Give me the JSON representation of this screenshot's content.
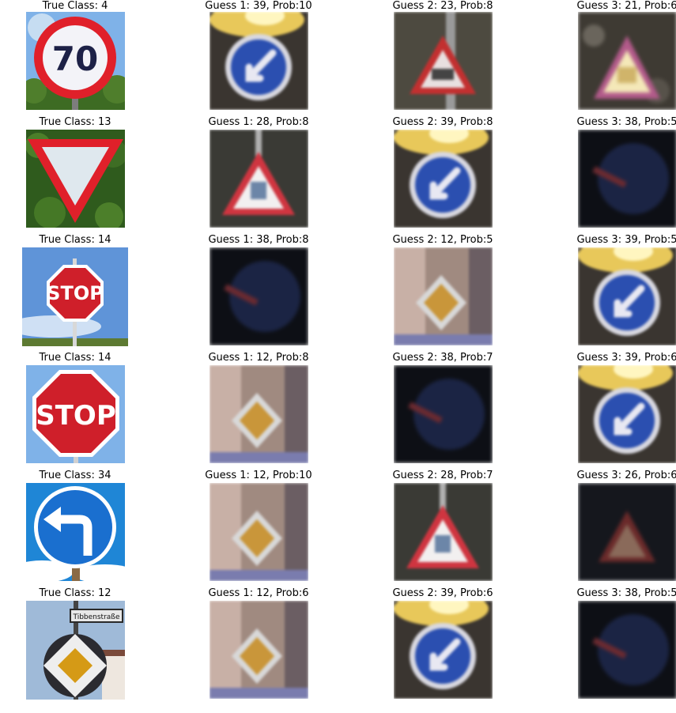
{
  "rows": [
    {
      "true_title": "True Class: 4",
      "guesses": [
        "Guess 1: 39, Prob:10",
        "Guess 2: 23, Prob:8",
        "Guess 3: 21, Prob:6"
      ],
      "sign": "speed-limit-70",
      "sign_text": "70"
    },
    {
      "true_title": "True Class: 13",
      "guesses": [
        "Guess 1: 28, Prob:8",
        "Guess 2: 39, Prob:8",
        "Guess 3: 38, Prob:5"
      ],
      "sign": "yield"
    },
    {
      "true_title": "True Class: 14",
      "guesses": [
        "Guess 1: 38, Prob:8",
        "Guess 2: 12, Prob:5",
        "Guess 3: 39, Prob:5"
      ],
      "sign": "stop",
      "sign_text": "STOP"
    },
    {
      "true_title": "True Class: 14",
      "guesses": [
        "Guess 1: 12, Prob:8",
        "Guess 2: 38, Prob:7",
        "Guess 3: 39, Prob:6"
      ],
      "sign": "stop",
      "sign_text": "STOP"
    },
    {
      "true_title": "True Class: 34",
      "guesses": [
        "Guess 1: 12, Prob:10",
        "Guess 2: 28, Prob:7",
        "Guess 3: 26, Prob:6"
      ],
      "sign": "turn-left-ahead"
    },
    {
      "true_title": "True Class: 12",
      "guesses": [
        "Guess 1: 12, Prob:6",
        "Guess 2: 39, Prob:6",
        "Guess 3: 38, Prob:5"
      ],
      "sign": "priority-road",
      "sign_text": "Tibbenstraße"
    }
  ],
  "colors": {
    "red": "#e0202a",
    "blue": "#2b5fc0",
    "sky": "#7fb2e8",
    "green": "#2f5b1d",
    "yellow": "#d59a16"
  }
}
